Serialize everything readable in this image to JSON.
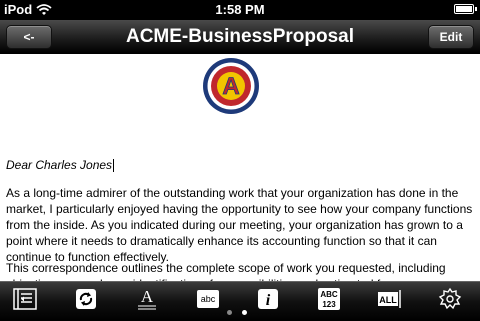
{
  "status": {
    "carrier": "iPod",
    "time": "1:58 PM",
    "battery_level": 1.0
  },
  "nav": {
    "back_label": "<-",
    "title": "ACME-BusinessProposal",
    "edit_label": "Edit"
  },
  "document": {
    "logo_letter": "A",
    "salutation": "Dear Charles Jones",
    "paragraphs": [
      "As a long-time admirer of the outstanding work that your organization has done in the market, I particularly enjoyed having the opportunity to see how your company functions from the inside. As you indicated during our meeting, your organization has grown to a point where it needs to dramatically enhance its accounting function so that it can continue to function effectively.",
      "This correspondence outlines the complete scope of work you requested, including objectives, procedures, identification of responsibilities and estimated fees."
    ]
  },
  "toolbar": {
    "items": [
      {
        "icon": "outline-icon"
      },
      {
        "icon": "rotate-icon"
      },
      {
        "icon": "font-icon",
        "glyph": "A"
      },
      {
        "icon": "spellcheck-icon",
        "glyph": "abc"
      },
      {
        "icon": "info-icon",
        "glyph": "i"
      },
      {
        "icon": "word-count-icon",
        "glyph": "ABC 123"
      },
      {
        "icon": "text-select-icon",
        "glyph": "ALL"
      },
      {
        "icon": "settings-icon"
      }
    ]
  },
  "pager": {
    "count": 2,
    "active": 2
  },
  "colors": {
    "logo_outer": "#1e3a7a",
    "logo_mid": "#c0282d",
    "logo_inner": "#f2c500"
  }
}
